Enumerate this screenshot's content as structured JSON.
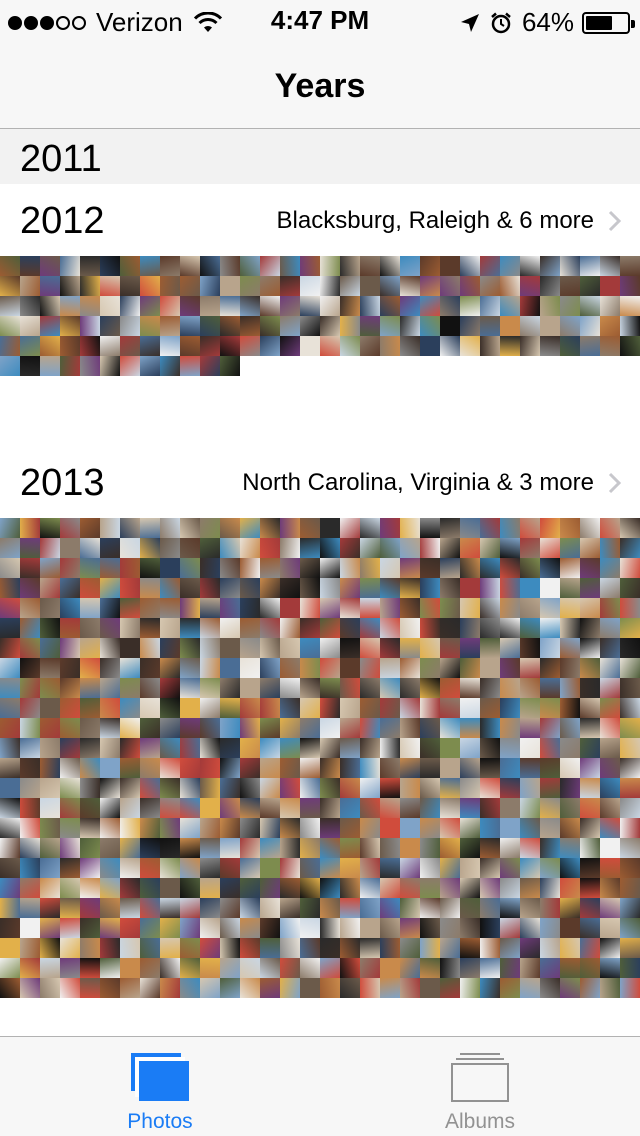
{
  "status_bar": {
    "carrier": "Verizon",
    "time": "4:47 PM",
    "battery": "64%",
    "battery_level": 0.64,
    "signal_bars_filled": 3,
    "signal_bars_total": 5,
    "icons": [
      "wifi-icon",
      "location-arrow-icon",
      "alarm-icon",
      "battery-icon"
    ]
  },
  "nav": {
    "title": "Years"
  },
  "years": [
    {
      "year": "2011",
      "locations": ""
    },
    {
      "year": "2012",
      "locations": "Blacksburg, Raleigh & 6 more"
    },
    {
      "year": "2013",
      "locations": "North Carolina, Virginia & 3 more"
    }
  ],
  "mosaic_palette": [
    "#3a2e28",
    "#6b5a4a",
    "#8c7b6a",
    "#b8a48c",
    "#d6c7b0",
    "#2b3f5c",
    "#4a6d95",
    "#7fa3c8",
    "#c9d6e3",
    "#e8e2d8",
    "#5b3a2a",
    "#9c5c32",
    "#c98a4b",
    "#4f5e3a",
    "#7d8c4e",
    "#2a2a2a",
    "#111111",
    "#f1f1f1",
    "#a33a3a",
    "#d04c3c",
    "#e2b04a",
    "#6e3b7a",
    "#3d8bbf",
    "#8a8a8a"
  ],
  "tab_bar": {
    "photos": {
      "label": "Photos",
      "active": true,
      "icon": "photos-stack-icon"
    },
    "albums": {
      "label": "Albums",
      "active": false,
      "icon": "albums-stack-icon"
    }
  },
  "colors": {
    "accent": "#1a7cf5",
    "inactive": "#929292",
    "bar_background": "#f7f7f7"
  }
}
